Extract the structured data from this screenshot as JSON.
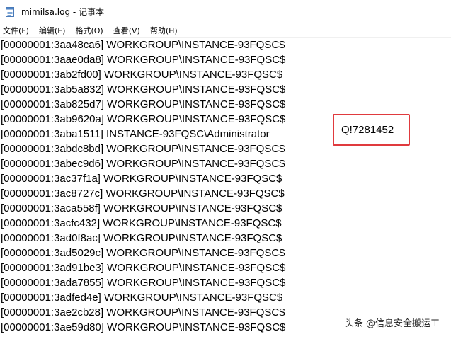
{
  "window": {
    "title": "mimilsa.log - 记事本",
    "icon": "notepad-icon"
  },
  "menu": [
    {
      "label": "文件(F)"
    },
    {
      "label": "编辑(E)"
    },
    {
      "label": "格式(O)"
    },
    {
      "label": "查看(V)"
    },
    {
      "label": "帮助(H)"
    }
  ],
  "lines": [
    "[00000001:3aa48ca6] WORKGROUP\\INSTANCE-93FQSC$",
    "[00000001:3aae0da8] WORKGROUP\\INSTANCE-93FQSC$",
    "[00000001:3ab2fd00] WORKGROUP\\INSTANCE-93FQSC$",
    "[00000001:3ab5a832] WORKGROUP\\INSTANCE-93FQSC$",
    "[00000001:3ab825d7] WORKGROUP\\INSTANCE-93FQSC$",
    "[00000001:3ab9620a] WORKGROUP\\INSTANCE-93FQSC$",
    "[00000001:3aba1511] INSTANCE-93FQSC\\Administrator",
    "[00000001:3abdc8bd] WORKGROUP\\INSTANCE-93FQSC$",
    "[00000001:3abec9d6] WORKGROUP\\INSTANCE-93FQSC$",
    "[00000001:3ac37f1a] WORKGROUP\\INSTANCE-93FQSC$",
    "[00000001:3ac8727c] WORKGROUP\\INSTANCE-93FQSC$",
    "[00000001:3aca558f] WORKGROUP\\INSTANCE-93FQSC$",
    "[00000001:3acfc432] WORKGROUP\\INSTANCE-93FQSC$",
    "[00000001:3ad0f8ac] WORKGROUP\\INSTANCE-93FQSC$",
    "[00000001:3ad5029c] WORKGROUP\\INSTANCE-93FQSC$",
    "[00000001:3ad91be3] WORKGROUP\\INSTANCE-93FQSC$",
    "[00000001:3ada7855] WORKGROUP\\INSTANCE-93FQSC$",
    "[00000001:3adfed4e] WORKGROUP\\INSTANCE-93FQSC$",
    "[00000001:3ae2cb28] WORKGROUP\\INSTANCE-93FQSC$",
    "[00000001:3ae59d80] WORKGROUP\\INSTANCE-93FQSC$"
  ],
  "highlight": {
    "text": "Q!7281452",
    "border_color": "#e03a3e"
  },
  "watermark": "头条 @信息安全搬运工"
}
